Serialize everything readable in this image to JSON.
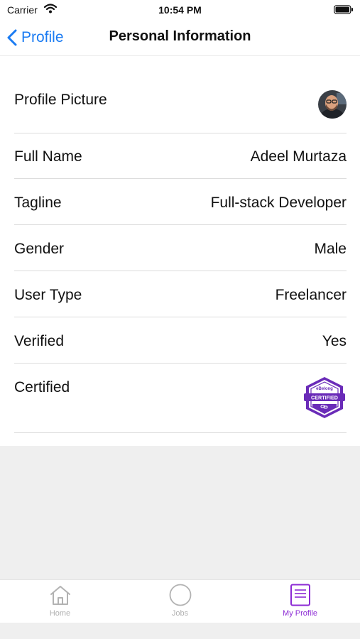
{
  "status_bar": {
    "carrier": "Carrier",
    "time": "10:54 PM"
  },
  "nav": {
    "back_label": "Profile",
    "title": "Personal Information"
  },
  "rows": [
    {
      "label": "Profile Picture",
      "kind": "avatar"
    },
    {
      "label": "Full Name",
      "value": "Adeel Murtaza"
    },
    {
      "label": "Tagline",
      "value": "Full-stack Developer"
    },
    {
      "label": "Gender",
      "value": "Male"
    },
    {
      "label": "User Type",
      "value": "Freelancer"
    },
    {
      "label": "Verified",
      "value": "Yes"
    },
    {
      "label": "Certified",
      "kind": "badge"
    }
  ],
  "badge": {
    "brand": "eBelong",
    "text": "CERTIFIED",
    "color": "#6a2bb8"
  },
  "tabs": [
    {
      "label": "Home",
      "icon": "home-icon",
      "active": false
    },
    {
      "label": "Jobs",
      "icon": "jobs-circle-icon",
      "active": false
    },
    {
      "label": "My Profile",
      "icon": "profile-document-icon",
      "active": true
    }
  ],
  "colors": {
    "accent_blue": "#1a7bf2",
    "active_tab": "#8c2bd4",
    "inactive_tab": "#b2b2b2"
  }
}
